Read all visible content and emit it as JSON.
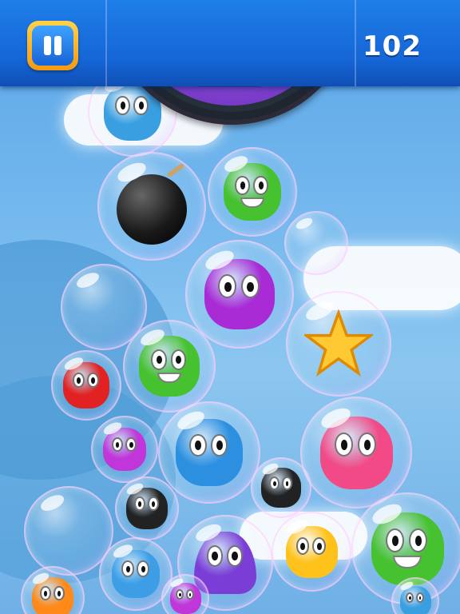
{
  "hud": {
    "score": "102",
    "pause_icon": "pause-icon",
    "launcher_icon": "launcher-arrow-icon"
  },
  "colors": {
    "sky": "#74b8ee",
    "hud_bar": "#1565d6",
    "pause_frame": "#f6a91c",
    "launcher_core": "#8a4ad8",
    "launcher_ring": "#4fd84f"
  },
  "pieces": [
    {
      "type": "blue-blob",
      "color": "#3a9fe0"
    },
    {
      "type": "bomb",
      "color": "#1a1a1a"
    },
    {
      "type": "green-blob",
      "color": "#46c12f"
    },
    {
      "type": "purple-blob",
      "color": "#a82bd6"
    },
    {
      "type": "star",
      "color": "#ffc933"
    },
    {
      "type": "red-spiky-blob",
      "color": "#e22222"
    },
    {
      "type": "green-blob",
      "color": "#46c12f"
    },
    {
      "type": "purple-blob",
      "color": "#c136d9"
    },
    {
      "type": "blue-blob",
      "color": "#2d8fe0"
    },
    {
      "type": "pink-heart-blob",
      "color": "#f24a86"
    },
    {
      "type": "black-blob",
      "color": "#222222"
    },
    {
      "type": "black-blob",
      "color": "#222222"
    },
    {
      "type": "blue-blob",
      "color": "#3d9ee6"
    },
    {
      "type": "purple-triangle-blob",
      "color": "#7a3ed6"
    },
    {
      "type": "yellow-blob",
      "color": "#ffc21a"
    },
    {
      "type": "green-blob",
      "color": "#46c12f"
    },
    {
      "type": "orange-blob",
      "color": "#ff8a1a"
    },
    {
      "type": "purple-blob",
      "color": "#c136d9"
    },
    {
      "type": "blue-blob",
      "color": "#3a9fe0"
    },
    {
      "type": "empty-bubble",
      "color": ""
    },
    {
      "type": "empty-bubble",
      "color": ""
    },
    {
      "type": "empty-bubble",
      "color": ""
    }
  ]
}
